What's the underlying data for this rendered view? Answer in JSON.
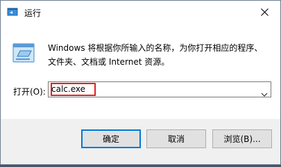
{
  "window": {
    "title": "运行",
    "icon": "run-icon"
  },
  "description": {
    "line1": "Windows 将根据你所输入的名称，为你打开相应的程序、",
    "line2": "文件夹、文档或 Internet 资源。"
  },
  "open_field": {
    "label": "打开(O):",
    "value": "calc.exe"
  },
  "buttons": {
    "ok": "确定",
    "cancel": "取消",
    "browse": "浏览(B)..."
  },
  "colors": {
    "highlight": "#e02020",
    "accent": "#0078d7"
  }
}
